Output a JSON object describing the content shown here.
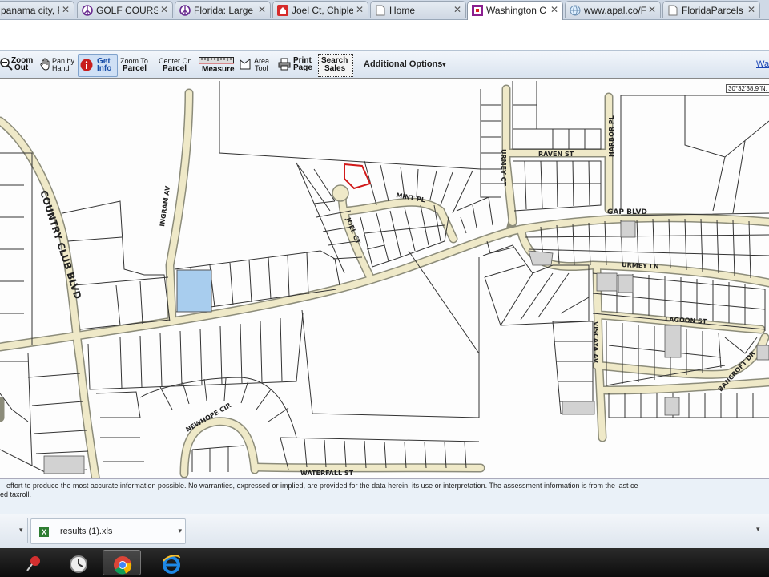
{
  "tabs": [
    {
      "title": "panama city, F",
      "icon": "none-icon"
    },
    {
      "title": "GOLF COURSE",
      "icon": "peace-icon"
    },
    {
      "title": "Florida: Large",
      "icon": "peace-icon"
    },
    {
      "title": "Joel Ct, Chiple",
      "icon": "house-icon"
    },
    {
      "title": "Home",
      "icon": "page-icon"
    },
    {
      "title": "Washington C",
      "icon": "gis-icon"
    },
    {
      "title": "www.apal.co/F",
      "icon": "globe-icon"
    },
    {
      "title": "FloridaParcels",
      "icon": "page-icon"
    }
  ],
  "toolbar": {
    "zoom_out": [
      "Zoom",
      "Out"
    ],
    "pan_by_hand": [
      "Pan by",
      "Hand"
    ],
    "get_info": [
      "Get",
      "Info"
    ],
    "zoom_to_parcel": [
      "Zoom To",
      "Parcel"
    ],
    "center_on_parcel": [
      "Center On",
      "Parcel"
    ],
    "measure": "Measure",
    "area_tool": [
      "Area",
      "Tool"
    ],
    "print_page": [
      "Print",
      "Page"
    ],
    "search_sales": [
      "Search",
      "Sales"
    ],
    "additional_options": "Additional Options",
    "right_link": "Wa"
  },
  "map": {
    "coordinate": "30°32'38.9\"N, ",
    "roads": {
      "country_club": "COUNTRY CLUB BLVD",
      "ingram": "INGRAM AV",
      "joel": "JOEL CT",
      "mint": "MINT PL",
      "urmey_ct": "URMEY CT",
      "raven": "RAVEN ST",
      "harbor": "HARBOR PL",
      "gap": "GAP BLVD",
      "urmey_ln": "URMEY LN",
      "lagoon": "LAGOON ST",
      "viscaya": "VISCAYA AV",
      "bancroft": "BANCROFT DR",
      "newhope": "NEWHOPE CIR",
      "waterfall": "WATERFALL ST"
    },
    "colors": {
      "selected_parcel": "#a8cdee",
      "highlight_outline": "#d11a1a",
      "road": "#efe9c8",
      "road_edge": "#8c8c7a"
    }
  },
  "disclaimer": {
    "line1": " effort to produce the most accurate information possible. No warranties, expressed or implied, are provided for the data herein, its use or interpretation. The assessment information is from the last ce",
    "line2": "ed taxroll."
  },
  "downloads": {
    "file": "results (1).xls"
  },
  "taskbar": {
    "apps": [
      "pin-icon",
      "clock-icon",
      "chrome-icon",
      "ie-icon"
    ]
  }
}
